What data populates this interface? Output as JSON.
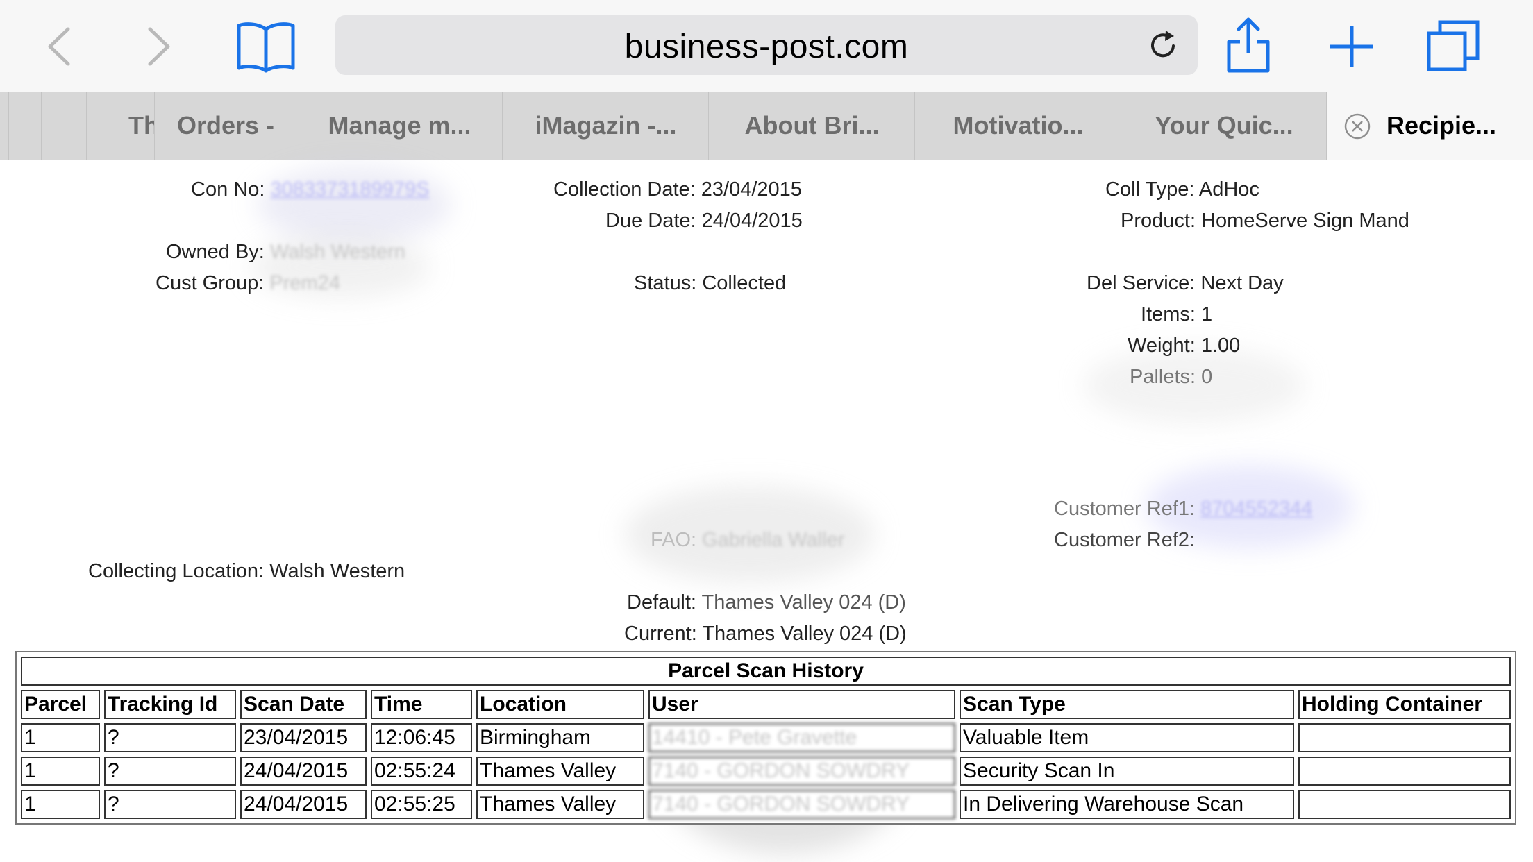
{
  "browser": {
    "url": "business-post.com",
    "tabs": [
      {
        "label": "Th"
      },
      {
        "label": "Orders -"
      },
      {
        "label": "Manage m..."
      },
      {
        "label": "iMagazin -..."
      },
      {
        "label": "About Bri..."
      },
      {
        "label": "Motivatio..."
      },
      {
        "label": "Your Quic..."
      }
    ],
    "active_tab": {
      "label": "Recipie..."
    },
    "colors": {
      "accent": "#1a73e8"
    }
  },
  "consignment": {
    "con_no": {
      "label": "Con No:",
      "value": "3083373189979S"
    },
    "owned_by": {
      "label": "Owned By:",
      "value": "Walsh Western"
    },
    "cust_group": {
      "label": "Cust Group:",
      "value": "Prem24"
    },
    "collection_date": {
      "label": "Collection Date:",
      "value": "23/04/2015"
    },
    "due_date": {
      "label": "Due Date:",
      "value": "24/04/2015"
    },
    "status": {
      "label": "Status:",
      "value": "Collected"
    },
    "coll_type": {
      "label": "Coll Type:",
      "value": "AdHoc"
    },
    "product": {
      "label": "Product:",
      "value": "HomeServe Sign Mand"
    },
    "del_service": {
      "label": "Del Service:",
      "value": "Next Day"
    },
    "items": {
      "label": "Items:",
      "value": "1"
    },
    "weight": {
      "label": "Weight:",
      "value": "1.00"
    },
    "pallets": {
      "label": "Pallets:",
      "value": "0"
    },
    "customer_ref1": {
      "label": "Customer Ref1:",
      "value": "8704552344"
    },
    "customer_ref2": {
      "label": "Customer Ref2:",
      "value": ""
    },
    "fao": {
      "label": "FAO:",
      "value": "Gabriella Waller"
    },
    "collecting_location": {
      "label": "Collecting Location:",
      "value": "Walsh Western"
    },
    "default_depot": {
      "label": "Default:",
      "value": "Thames Valley 024 (D)"
    },
    "current_depot": {
      "label": "Current:",
      "value": "Thames Valley 024 (D)"
    }
  },
  "scan_history": {
    "title": "Parcel Scan History",
    "columns": [
      "Parcel",
      "Tracking Id",
      "Scan Date",
      "Time",
      "Location",
      "User",
      "Scan Type",
      "Holding Container"
    ],
    "rows": [
      {
        "parcel": "1",
        "tracking_id": "?",
        "scan_date": "23/04/2015",
        "time": "12:06:45",
        "location": "Birmingham",
        "user": "14410 - Pete Gravette",
        "scan_type": "Valuable Item",
        "holding_container": ""
      },
      {
        "parcel": "1",
        "tracking_id": "?",
        "scan_date": "24/04/2015",
        "time": "02:55:24",
        "location": "Thames Valley",
        "user": "7140 - GORDON SOWDRY",
        "scan_type": "Security Scan In",
        "holding_container": ""
      },
      {
        "parcel": "1",
        "tracking_id": "?",
        "scan_date": "24/04/2015",
        "time": "02:55:25",
        "location": "Thames Valley",
        "user": "7140 - GORDON SOWDRY",
        "scan_type": "In Delivering Warehouse Scan",
        "holding_container": ""
      }
    ]
  }
}
